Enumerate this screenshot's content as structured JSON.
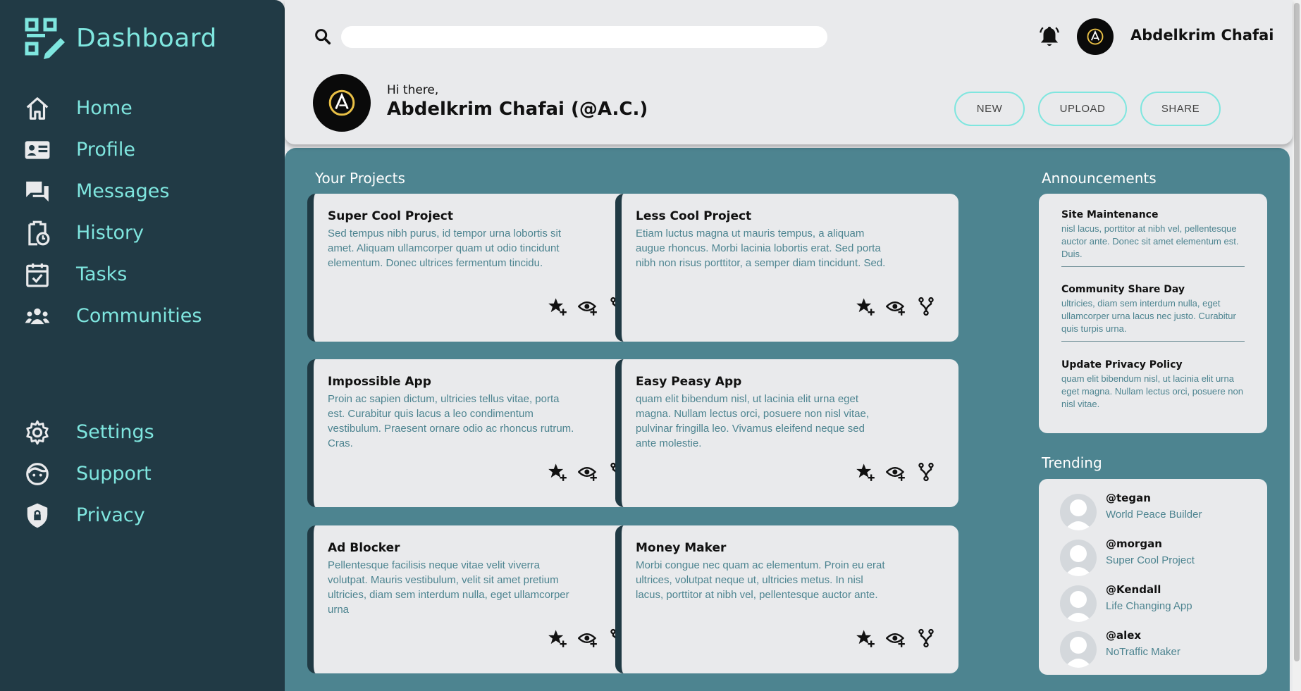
{
  "colors": {
    "sidebar_bg": "#213a45",
    "accent": "#7fe6df",
    "main_bg": "#4d8490",
    "card_bg": "#e9eaec",
    "card_border": "#203a44"
  },
  "sidebar": {
    "brand": "Dashboard",
    "brand_icon": "dashboard-logo-icon",
    "items_top": [
      {
        "label": "Home",
        "icon": "home-icon"
      },
      {
        "label": "Profile",
        "icon": "id-card-icon"
      },
      {
        "label": "Messages",
        "icon": "chat-icon"
      },
      {
        "label": "History",
        "icon": "clipboard-history-icon"
      },
      {
        "label": "Tasks",
        "icon": "calendar-check-icon"
      },
      {
        "label": "Communities",
        "icon": "people-icon"
      }
    ],
    "items_bottom": [
      {
        "label": "Settings",
        "icon": "gear-icon"
      },
      {
        "label": "Support",
        "icon": "support-face-icon"
      },
      {
        "label": "Privacy",
        "icon": "shield-lock-icon"
      }
    ]
  },
  "header": {
    "search_placeholder": "",
    "user_name": "Abdelkrim Chafai",
    "greeting": "Hi there,",
    "greeting_name": "Abdelkrim Chafai (@A.C.)",
    "buttons": {
      "new": "NEW",
      "upload": "UPLOAD",
      "share": "SHARE"
    }
  },
  "projects": {
    "title": "Your Projects",
    "items": [
      {
        "title": "Super Cool Project",
        "desc": "Sed tempus nibh purus, id tempor urna lobortis sit amet. Aliquam ullamcorper quam ut odio tincidunt elementum. Donec ultrices fermentum tincidu."
      },
      {
        "title": "Less Cool Project",
        "desc": "Etiam luctus magna ut mauris tempus, a aliquam augue rhoncus. Morbi lacinia lobortis erat. Sed porta nibh non risus porttitor, a semper diam tincidunt. Sed."
      },
      {
        "title": "Impossible App",
        "desc": "Proin ac sapien dictum, ultricies tellus vitae, porta est. Curabitur quis lacus a leo condimentum vestibulum. Praesent ornare odio ac rhoncus rutrum. Cras."
      },
      {
        "title": "Easy Peasy App",
        "desc": "quam elit bibendum nisl, ut lacinia elit urna eget magna. Nullam lectus orci, posuere non nisl vitae, pulvinar fringilla leo. Vivamus eleifend neque sed ante molestie."
      },
      {
        "title": "Ad Blocker",
        "desc": "Pellentesque facilisis neque vitae velit viverra volutpat. Mauris vestibulum, velit sit amet pretium ultricies, diam sem interdum nulla, eget ullamcorper urna"
      },
      {
        "title": "Money Maker",
        "desc": "Morbi congue nec quam ac elementum. Proin eu erat ultrices, volutpat neque ut, ultricies metus. In nisl lacus, porttitor at nibh vel, pellentesque auctor ante."
      }
    ]
  },
  "announcements": {
    "title": "Announcements",
    "items": [
      {
        "title": "Site Maintenance",
        "desc": "nisl lacus, porttitor at nibh vel, pellentesque auctor ante. Donec sit amet elementum est. Duis."
      },
      {
        "title": "Community Share Day",
        "desc": "ultricies, diam sem interdum nulla, eget ullamcorper urna lacus nec justo. Curabitur quis turpis urna."
      },
      {
        "title": "Update Privacy Policy",
        "desc": "quam elit bibendum nisl, ut lacinia elit urna eget magna. Nullam lectus orci, posuere non nisl vitae."
      }
    ]
  },
  "trending": {
    "title": "Trending",
    "items": [
      {
        "user": "@tegan",
        "project": "World Peace Builder"
      },
      {
        "user": "@morgan",
        "project": "Super Cool Project"
      },
      {
        "user": "@Kendall",
        "project": "Life Changing App"
      },
      {
        "user": "@alex",
        "project": "NoTraffic Maker"
      }
    ]
  }
}
